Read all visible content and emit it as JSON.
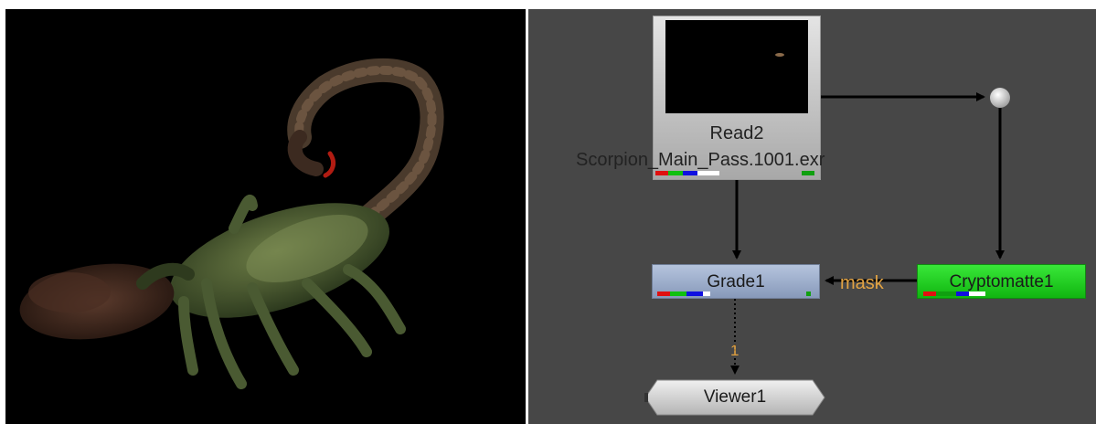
{
  "viewer": {
    "subject": "scorpion"
  },
  "nodes": {
    "read": {
      "label": "Read2",
      "file": "Scorpion_Main_Pass.1001.exr"
    },
    "grade": {
      "label": "Grade1"
    },
    "cryptomatte": {
      "label": "Cryptomatte1"
    },
    "viewer": {
      "label": "Viewer1"
    }
  },
  "connections": {
    "mask_label": "mask",
    "viewer_input": "1"
  },
  "colors": {
    "graph_bg": "#474747",
    "read_node": "#cfcfcf",
    "grade_node": "#9aabcb",
    "cryptomatte_node": "#22cf22",
    "viewer_node": "#d8d8d8",
    "wire": "#000000",
    "label_accent": "#e4a443"
  }
}
